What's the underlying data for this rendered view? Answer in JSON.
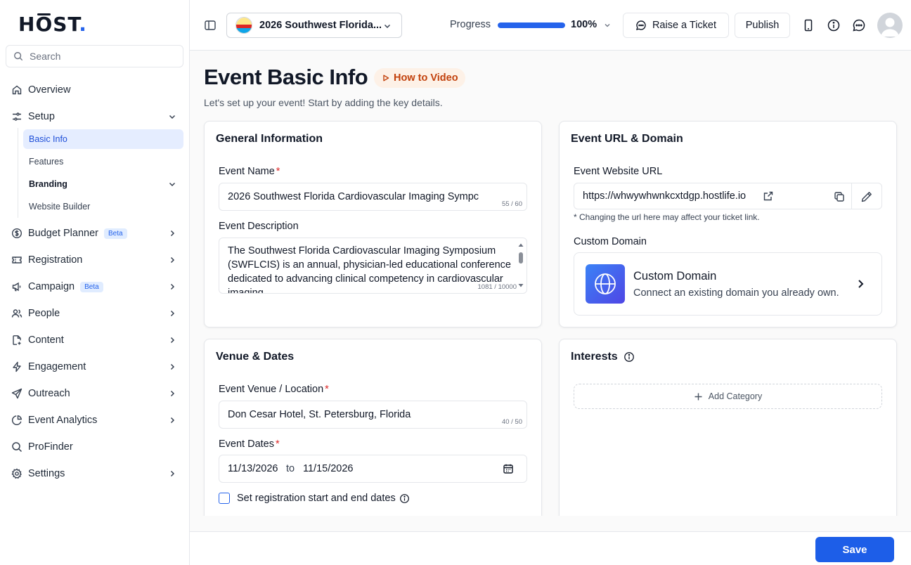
{
  "brand": {
    "logo_text": "HŌST",
    "accent": "#2563eb"
  },
  "sidebar": {
    "search_placeholder": "Search",
    "items": [
      {
        "label": "Overview",
        "icon": "home-icon"
      },
      {
        "label": "Setup",
        "icon": "sliders-icon",
        "expanded": true,
        "subitems": [
          {
            "label": "Basic Info",
            "active": true
          },
          {
            "label": "Features"
          },
          {
            "label": "Branding",
            "has_children": true
          },
          {
            "label": "Website Builder"
          }
        ]
      },
      {
        "label": "Budget Planner",
        "icon": "dollar-icon",
        "badge": "Beta"
      },
      {
        "label": "Registration",
        "icon": "ticket-icon"
      },
      {
        "label": "Campaign",
        "icon": "megaphone-icon",
        "badge": "Beta"
      },
      {
        "label": "People",
        "icon": "users-icon"
      },
      {
        "label": "Content",
        "icon": "file-icon"
      },
      {
        "label": "Engagement",
        "icon": "bolt-icon"
      },
      {
        "label": "Outreach",
        "icon": "send-icon"
      },
      {
        "label": "Event Analytics",
        "icon": "pie-chart-icon"
      },
      {
        "label": "ProFinder",
        "icon": "search-icon"
      },
      {
        "label": "Settings",
        "icon": "gear-icon"
      }
    ]
  },
  "topbar": {
    "event_name": "2026 Southwest Florida...",
    "progress_label": "Progress",
    "progress_value": "100%",
    "progress_fraction": 1.0,
    "raise_ticket_label": "Raise a Ticket",
    "publish_label": "Publish"
  },
  "page": {
    "title": "Event Basic Info",
    "video_label": "How to Video",
    "subtitle": "Let's set up your event! Start by adding the key details."
  },
  "general": {
    "title": "General Information",
    "name_label": "Event Name",
    "name_value": "2026 Southwest Florida Cardiovascular Imaging Sympc",
    "name_count": "55 / 60",
    "desc_label": "Event Description",
    "desc_value": "The Southwest Florida Cardiovascular Imaging Symposium (SWFLCIS) is an annual, physician-led educational conference dedicated to advancing clinical competency in cardiovascular imaging",
    "desc_count": "1081 / 10000"
  },
  "url_domain": {
    "title": "Event URL & Domain",
    "url_label": "Event Website URL",
    "url_value": "https://whwywhwnkcxtdgp.hostlife.io",
    "url_note": "* Changing the url here may affect your ticket link.",
    "custom_label": "Custom Domain",
    "custom_title": "Custom Domain",
    "custom_desc": "Connect an existing domain you already own."
  },
  "venue": {
    "title": "Venue & Dates",
    "location_label": "Event Venue / Location",
    "location_value": "Don Cesar Hotel, St. Petersburg, Florida",
    "location_count": "40 / 50",
    "dates_label": "Event Dates",
    "start_date": "11/13/2026",
    "to_label": "to",
    "end_date": "11/15/2026",
    "reg_dates_label": "Set registration start and end dates"
  },
  "interests": {
    "title": "Interests",
    "add_label": "Add Category"
  },
  "footer": {
    "save_label": "Save"
  }
}
